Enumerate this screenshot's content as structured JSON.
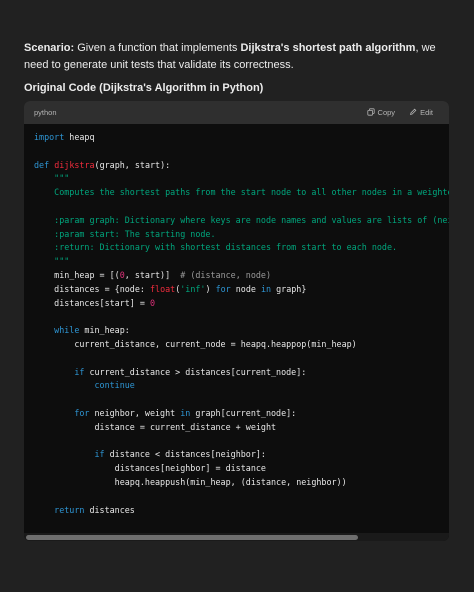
{
  "scenario": {
    "label": "Scenario:",
    "text_before": " Given a function that implements ",
    "bold_term": "Dijkstra's shortest path algorithm",
    "text_after": ", we need to generate unit tests that validate its correctness."
  },
  "section_heading": "Original Code (Dijkstra's Algorithm in Python)",
  "code_block": {
    "language": "python",
    "copy_label": "Copy",
    "edit_label": "Edit",
    "copy_icon": "copy-icon",
    "edit_icon": "edit-icon"
  },
  "colors": {
    "background": "#212121",
    "code_background": "#0d0d0d",
    "header_background": "#2f2f2f",
    "keyword": "#2e95d3",
    "function_name": "#f22c3d",
    "string": "#00a67d",
    "number": "#df3079",
    "comment": "#9a9a9a"
  },
  "code_lines": [
    [
      [
        "kw",
        "import"
      ],
      [
        "p",
        " heapq"
      ]
    ],
    [],
    [
      [
        "kw",
        "def"
      ],
      [
        "p",
        " "
      ],
      [
        "fn",
        "dijkstra"
      ],
      [
        "p",
        "(graph, start):"
      ]
    ],
    [
      [
        "str",
        "    \"\"\""
      ]
    ],
    [
      [
        "str",
        "    Computes the shortest paths from the start node to all other nodes in a weighted graph."
      ]
    ],
    [],
    [
      [
        "str",
        "    :param graph: Dictionary where keys are node names and values are lists of (neighbor, weight) tuples."
      ]
    ],
    [
      [
        "str",
        "    :param start: The starting node."
      ]
    ],
    [
      [
        "str",
        "    :return: Dictionary with shortest distances from start to each node."
      ]
    ],
    [
      [
        "str",
        "    \"\"\""
      ]
    ],
    [
      [
        "p",
        "    min_heap = [("
      ],
      [
        "num",
        "0"
      ],
      [
        "p",
        ", start)]  "
      ],
      [
        "cmt",
        "# (distance, node)"
      ]
    ],
    [
      [
        "p",
        "    distances = {node: "
      ],
      [
        "fn",
        "float"
      ],
      [
        "p",
        "("
      ],
      [
        "str",
        "'inf'"
      ],
      [
        "p",
        ") "
      ],
      [
        "kw",
        "for"
      ],
      [
        "p",
        " node "
      ],
      [
        "kw",
        "in"
      ],
      [
        "p",
        " graph}"
      ]
    ],
    [
      [
        "p",
        "    distances[start] = "
      ],
      [
        "num",
        "0"
      ]
    ],
    [],
    [
      [
        "kw",
        "    while"
      ],
      [
        "p",
        " min_heap:"
      ]
    ],
    [
      [
        "p",
        "        current_distance, current_node = heapq.heappop(min_heap)"
      ]
    ],
    [],
    [
      [
        "kw",
        "        if"
      ],
      [
        "p",
        " current_distance > distances[current_node]:"
      ]
    ],
    [
      [
        "kw",
        "            continue"
      ]
    ],
    [],
    [
      [
        "kw",
        "        for"
      ],
      [
        "p",
        " neighbor, weight "
      ],
      [
        "kw",
        "in"
      ],
      [
        "p",
        " graph[current_node]:"
      ]
    ],
    [
      [
        "p",
        "            distance = current_distance + weight"
      ]
    ],
    [],
    [
      [
        "kw",
        "            if"
      ],
      [
        "p",
        " distance < distances[neighbor]:"
      ]
    ],
    [
      [
        "p",
        "                distances[neighbor] = distance"
      ]
    ],
    [
      [
        "p",
        "                heapq.heappush(min_heap, (distance, neighbor))"
      ]
    ],
    [],
    [
      [
        "kw",
        "    return"
      ],
      [
        "p",
        " distances"
      ]
    ]
  ]
}
